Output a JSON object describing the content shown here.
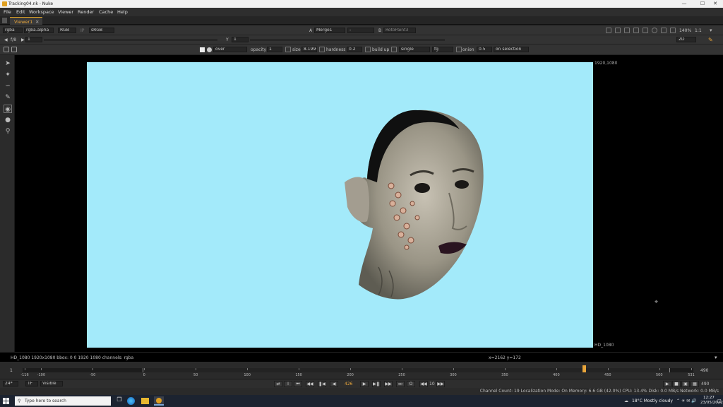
{
  "window": {
    "title": "Tracking04.nk - Nuke"
  },
  "menu": [
    "File",
    "Edit",
    "Workspace",
    "Viewer",
    "Render",
    "Cache",
    "Help"
  ],
  "tabs": [
    {
      "label": "Viewer1"
    }
  ],
  "viewer_bar": {
    "channels": "rgba",
    "alpha": "rgba.alpha",
    "display": "RGB",
    "ip": "IP",
    "colorspace": "sRGB",
    "input_a_letter": "A",
    "input_a": "Merge1",
    "input_op": "-",
    "input_b_letter": "B",
    "input_b": "RotoPaint3",
    "zoom": "140%",
    "proxy": "1:1",
    "view_mode": "2D"
  },
  "gain_bar": {
    "fstop": "f/8",
    "gain": "1",
    "y_label": "Y",
    "gamma": "1"
  },
  "paint_bar": {
    "blend": "over",
    "opacity_label": "opacity",
    "opacity": "1",
    "size_label": "size",
    "size": "8.1996",
    "hardness_label": "hardness",
    "hardness": "0.2",
    "buildup_label": "build up",
    "mode": "single",
    "fg": "fg",
    "onion_label": "onion",
    "onion": "0.5",
    "selection": "on selection"
  },
  "frame": {
    "top_right": "1920,1080",
    "bottom_right": "HD_1080"
  },
  "info": {
    "format": "HD_1080 1920x1080  bbox: 0 0 1920 1080 channels: rgba",
    "coords": "x=2162 y=172"
  },
  "timeline": {
    "in_frame": "1",
    "out_frame": "490",
    "ticks": [
      "-116",
      "-100",
      "-50",
      "0",
      "50",
      "100",
      "150",
      "200",
      "250",
      "300",
      "350",
      "400",
      "450",
      "500",
      "531"
    ],
    "current": "426"
  },
  "playback": {
    "fps": "24*",
    "tf": "TF",
    "visible": "Visible",
    "current_frame": "426",
    "step": "10",
    "end_frame": "490"
  },
  "status": "Channel Count: 19  Localization Mode: On  Memory: 6.6 GB (42.0%)  CPU: 13.4%  Disk: 0.0 MB/s  Network: 0.0 MB/s",
  "taskbar": {
    "search_placeholder": "Type here to search",
    "weather": "18°C  Mostly cloudy",
    "time": "12:27",
    "date": "23/05/2022"
  }
}
